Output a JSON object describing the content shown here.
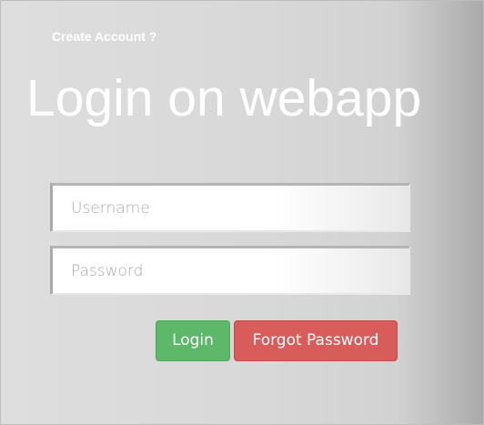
{
  "header": {
    "create_account_link": "Create Account ?",
    "title": "Login on webapp"
  },
  "form": {
    "username_placeholder": "Username",
    "username_value": "",
    "password_placeholder": "Password",
    "password_value": ""
  },
  "buttons": {
    "login_label": "Login",
    "forgot_label": "Forgot Password"
  },
  "colors": {
    "login_button": "#5db869",
    "forgot_button": "#d75c5a",
    "title_text": "#ffffff"
  }
}
